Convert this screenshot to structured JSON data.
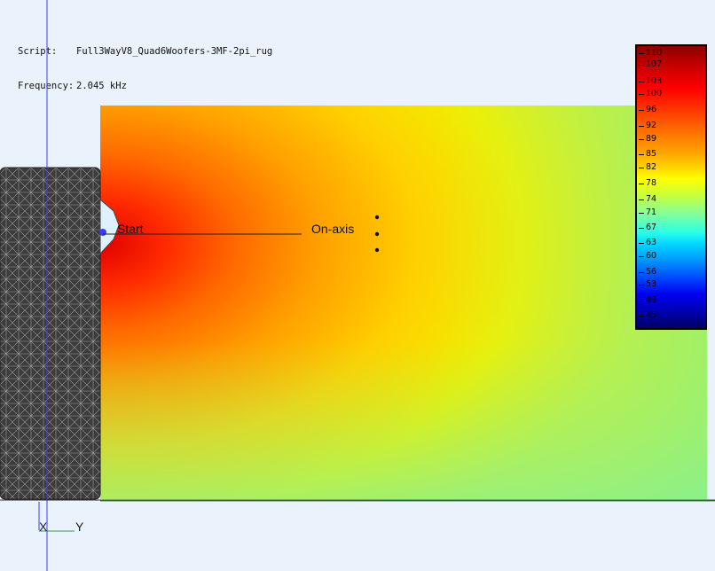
{
  "info": {
    "script_key": "Script:",
    "script_value": "Full3WayV8_Quad6Woofers-3MF-2pi_rug",
    "frequency_key": "Frequency:",
    "frequency_value": "2.045 kHz"
  },
  "labels": {
    "start": "Start",
    "on_axis": "On-axis"
  },
  "axes": {
    "x": "X",
    "y": "Y"
  },
  "legend": {
    "ticks": [
      "110",
      "107",
      "103",
      "100",
      "96",
      "92",
      "89",
      "85",
      "82",
      "78",
      "74",
      "71",
      "67",
      "63",
      "60",
      "56",
      "53",
      "49",
      "45"
    ]
  },
  "colors": {
    "background": "#eaf3fc",
    "axis_line": "#3a3aff",
    "mesh_fill": "#3c3c3c"
  }
}
